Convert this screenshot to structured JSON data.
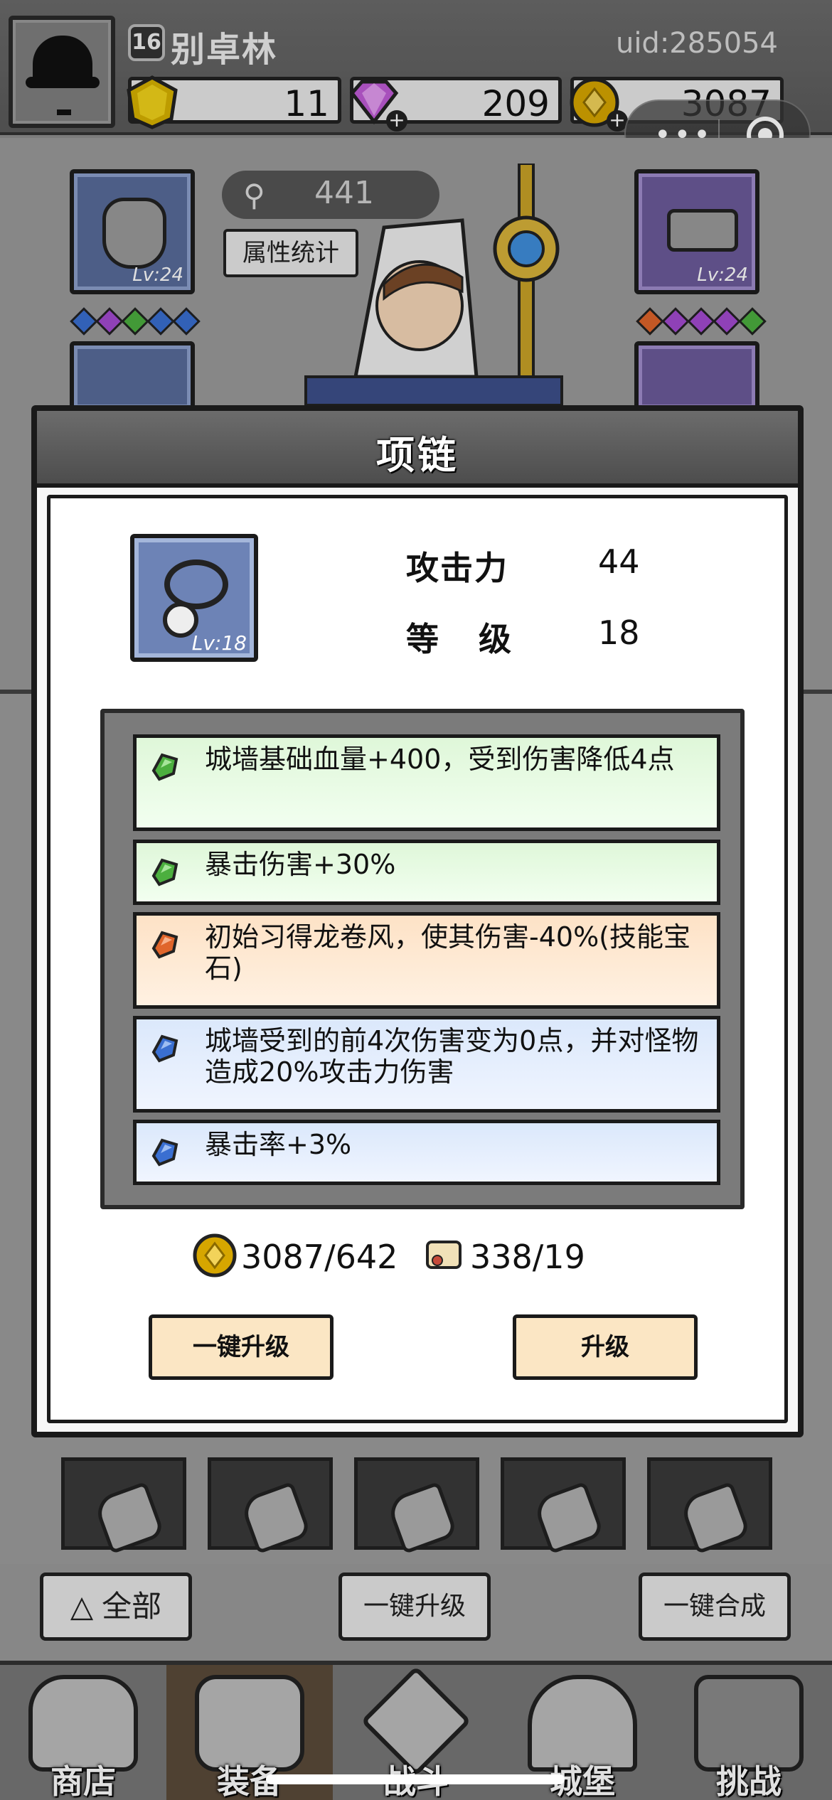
{
  "player": {
    "level": "16",
    "name": "别卓林",
    "uid": "uid:285054"
  },
  "resources": {
    "gem": "11",
    "diamond": "209",
    "coin": "3087"
  },
  "background": {
    "power": "441",
    "stats_button": "属性统计",
    "left_slot_level": "Lv:24",
    "right_slot_level": "Lv:24"
  },
  "dialog": {
    "title": "项链",
    "item_level": "Lv:18",
    "stats": [
      {
        "label": "攻击力",
        "value": "44"
      },
      {
        "label": "等级",
        "value": "18"
      }
    ],
    "effects": [
      {
        "text": "城墙基础血量+400，受到伤害降低4点",
        "color": "green"
      },
      {
        "text": "暴击伤害+30%",
        "color": "green"
      },
      {
        "text": "初始习得龙卷风，使其伤害-40%(技能宝石)",
        "color": "orange"
      },
      {
        "text": "城墙受到的前4次伤害变为0点，并对怪物造成20%攻击力伤害",
        "color": "blue"
      },
      {
        "text": "暴击率+3%",
        "color": "blue"
      }
    ],
    "costs": {
      "coin": "3087/642",
      "scroll": "338/19"
    },
    "buttons": {
      "bulk_upgrade": "一键升级",
      "upgrade": "升级"
    }
  },
  "bottom_controls": {
    "filter_all": "全部",
    "bulk_upgrade": "一键升级",
    "bulk_merge": "一键合成"
  },
  "nav": [
    {
      "label": "商店",
      "icon": "shop-icon"
    },
    {
      "label": "装备",
      "icon": "bag-icon",
      "active": true
    },
    {
      "label": "战斗",
      "icon": "swords-icon"
    },
    {
      "label": "城堡",
      "icon": "castle-icon"
    },
    {
      "label": "挑战",
      "icon": "challenge-icon"
    }
  ],
  "colors": {
    "green_gem": "#4caf3f",
    "orange_gem": "#e0652b",
    "blue_gem": "#3a6fd1",
    "button_fill": "#fbe6c4"
  }
}
